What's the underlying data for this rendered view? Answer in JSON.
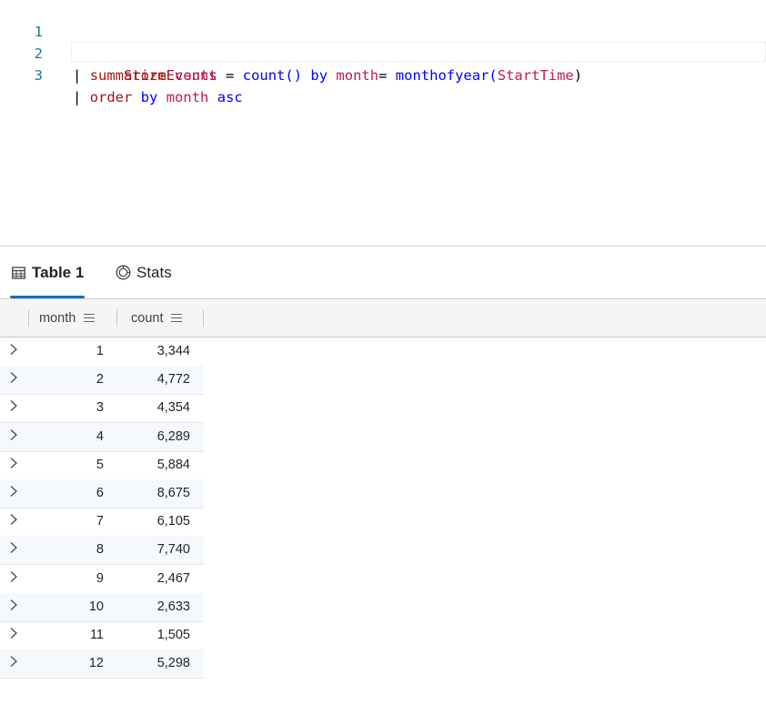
{
  "editor": {
    "lines": [
      {
        "num": "1",
        "tokens": {
          "table": "StormEvents"
        }
      },
      {
        "num": "2",
        "tokens": {
          "pipe": "|",
          "op": "summarize",
          "var": "count",
          "eq": "=",
          "fn": "count()",
          "by": "by",
          "col": "month",
          "eq2": "=",
          "fn2": "monthofyear(",
          "col2": "StartTime",
          "close": ")"
        }
      },
      {
        "num": "3",
        "tokens": {
          "pipe": "|",
          "op": "order",
          "by": "by",
          "col": "month",
          "asc": "asc"
        }
      }
    ]
  },
  "tabs": {
    "table_label": "Table 1",
    "stats_label": "Stats"
  },
  "grid": {
    "columns": [
      "month",
      "count"
    ],
    "rows": [
      {
        "month": "1",
        "count": "3,344"
      },
      {
        "month": "2",
        "count": "4,772"
      },
      {
        "month": "3",
        "count": "4,354"
      },
      {
        "month": "4",
        "count": "6,289"
      },
      {
        "month": "5",
        "count": "5,884"
      },
      {
        "month": "6",
        "count": "8,675"
      },
      {
        "month": "7",
        "count": "6,105"
      },
      {
        "month": "8",
        "count": "7,740"
      },
      {
        "month": "9",
        "count": "2,467"
      },
      {
        "month": "10",
        "count": "2,633"
      },
      {
        "month": "11",
        "count": "1,505"
      },
      {
        "month": "12",
        "count": "5,298"
      }
    ]
  },
  "colors": {
    "accent": "#0f6cbd",
    "line_number": "#237893",
    "keyword_red": "#a31515",
    "keyword_blue": "#0000ff",
    "column_pink": "#c2185b"
  },
  "icons": {
    "table_tab": "table-icon",
    "stats_tab": "stats-icon",
    "column_menu": "menu-icon",
    "row_expand": "chevron-right-icon"
  }
}
